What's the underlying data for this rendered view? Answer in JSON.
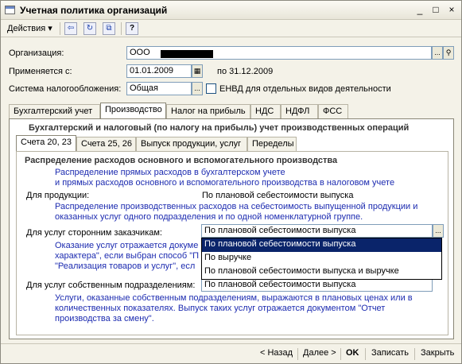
{
  "window": {
    "title": "Учетная политика организаций",
    "controls": [
      "_",
      "□",
      "×"
    ]
  },
  "toolbar": {
    "actions_label": "Действия",
    "icons": [
      "back-arrow-icon",
      "refresh-icon",
      "copy-icon",
      "help-icon"
    ],
    "help_glyph": "?"
  },
  "form": {
    "org_label": "Организация:",
    "org_value": "ООО",
    "applies_label": "Применяется с:",
    "applies_value": "01.01.2009",
    "applies_to": "по 31.12.2009",
    "tax_system_label": "Система налогообложения:",
    "tax_system_value": "Общая",
    "envd_label": "ЕНВД для отдельных видов деятельности"
  },
  "tabs": [
    "Бухгалтерский учет",
    "Производство",
    "Налог на прибыль",
    "НДС",
    "НДФЛ",
    "ФСС"
  ],
  "active_tab": 1,
  "production": {
    "heading": "Бухгалтерский и налоговый (по налогу на прибыль) учет производственных операций",
    "subtabs": [
      "Счета 20, 23",
      "Счета 25, 26",
      "Выпуск продукции, услуг",
      "Переделы"
    ],
    "section_title": "Распределение расходов основного и вспомогательного производства",
    "section_note_1": "Распределение прямых расходов в бухгалтерском учете",
    "section_note_2": "и прямых расходов основного и вспомогательного производства в налоговом учете",
    "products_label": "Для продукции:",
    "products_value": "По плановой себестоимости выпуска",
    "products_note_1": "Распределение производственных расходов на себестоимость выпущенной продукции и",
    "products_note_2": "оказанных услуг одного подразделения и по одной номенклатурной группе.",
    "third_party_label": "Для услуг сторонним заказчикам:",
    "third_party_value": "По плановой себестоимости выпуска",
    "third_party_note_1": "Оказание услуг отражается докуме",
    "third_party_note_2": "характера\", если выбран способ \"П",
    "third_party_note_3": "\"Реализация товаров и услуг\", есл",
    "own_label": "Для услуг собственным подразделениям:",
    "own_value": "По плановой себестоимости выпуска",
    "own_note_1": "Услуги, оказанные собственным подразделениям, выражаются в плановых ценах или в",
    "own_note_2": "количественных показателях. Выпуск таких услуг отражается документом \"Отчет",
    "own_note_3": "производства за смену\"."
  },
  "dropdown": {
    "options": [
      "По плановой себестоимости выпуска",
      "По выручке",
      "По плановой себестоимости выпуска и выручке"
    ],
    "selected_index": 0
  },
  "bottom": {
    "back": "< Назад",
    "next": "Далее >",
    "ok": "OK",
    "save": "Записать",
    "close": "Закрыть"
  },
  "colors": {
    "accent": "#0a246a",
    "note_text": "#1c2bb0",
    "window_bg": "#f4f2e8"
  }
}
